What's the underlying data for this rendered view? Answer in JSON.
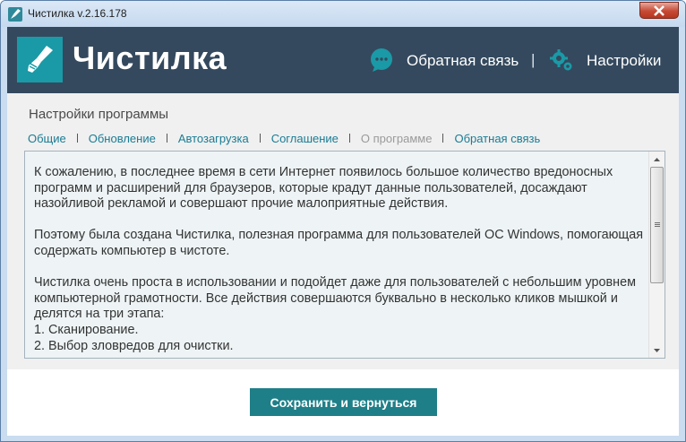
{
  "window": {
    "title": "Чистилка v.2.16.178"
  },
  "header": {
    "logo_text": "Чистилка",
    "feedback_label": "Обратная связь",
    "separator": "|",
    "settings_label": "Настройки"
  },
  "content": {
    "section_title": "Настройки программы",
    "tabs": [
      {
        "label": "Общие"
      },
      {
        "label": "Обновление"
      },
      {
        "label": "Автозагрузка"
      },
      {
        "label": "Соглашение"
      },
      {
        "label": "О программе"
      },
      {
        "label": "Обратная связь"
      }
    ],
    "about_text": "К сожалению, в последнее время в сети Интернет появилось большое количество вредоносных программ и расширений для браузеров, которые крадут данные пользователей, досаждают назойливой рекламой и совершают прочие малоприятные действия.\n\nПоэтому была создана Чистилка, полезная программа для пользователей ОС Windows, помогающая содержать компьютер в чистоте.\n\nЧистилка очень проста в использовании и подойдет даже для пользователей с небольшим уровнем компьютерной грамотности. Все действия совершаются буквально в несколько кликов мышкой и делятся на три этапа:\n1. Сканирование.\n2. Выбор зловредов для очистки."
  },
  "footer": {
    "save_label": "Сохранить и вернуться"
  },
  "colors": {
    "header_bg": "#34495e",
    "accent": "#1a9aa6",
    "link": "#1a7c94",
    "button": "#1f7f88"
  }
}
